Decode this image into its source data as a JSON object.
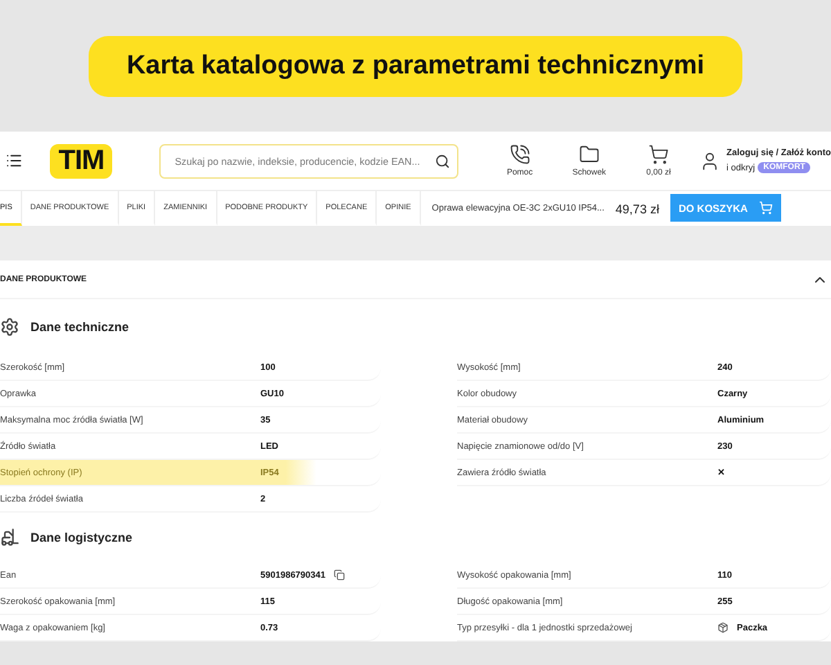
{
  "banner": {
    "title": "Karta katalogowa z parametrami technicznymi"
  },
  "header": {
    "logo": "TIM",
    "search": {
      "placeholder": "Szukaj po nazwie, indeksie, producencie, kodzie EAN..."
    },
    "actions": [
      {
        "kind": "phone",
        "label": "Pomoc"
      },
      {
        "kind": "folder",
        "label": "Schowek"
      },
      {
        "kind": "cart",
        "label": "0,00 zł"
      }
    ],
    "account": {
      "line1": "Zaloguj się / Załóż konto",
      "line2": "i odkryj",
      "badge": "KOMFORT"
    }
  },
  "tabs": [
    {
      "label": "PIS",
      "selected": true
    },
    {
      "label": "DANE PRODUKTOWE",
      "selected": false
    },
    {
      "label": "PLIKI",
      "selected": false
    },
    {
      "label": "ZAMIENNIKI",
      "selected": false
    },
    {
      "label": "PODOBNE PRODUKTY",
      "selected": false
    },
    {
      "label": "POLECANE",
      "selected": false
    },
    {
      "label": "OPINIE",
      "selected": false
    }
  ],
  "product": {
    "name": "Oprawa elewacyjna OE-3C 2xGU10 IP54...",
    "price": "49,73 zł",
    "button": "DO KOSZYKA"
  },
  "panel": {
    "title": "DANE PRODUKTOWE",
    "expanded": true,
    "sections": [
      {
        "kind": "technical",
        "title": "Dane techniczne",
        "left": [
          {
            "label": "Szerokość [mm]",
            "value": "100",
            "highlighted": false,
            "kind": "plain"
          },
          {
            "label": "Oprawka",
            "value": "GU10",
            "highlighted": false,
            "kind": "plain"
          },
          {
            "label": "Maksymalna moc źródła światła [W]",
            "value": "35",
            "highlighted": false,
            "kind": "plain"
          },
          {
            "label": "Źródło światła",
            "value": "LED",
            "highlighted": false,
            "kind": "plain"
          },
          {
            "label": "Stopień ochrony (IP)",
            "value": "IP54",
            "highlighted": true,
            "kind": "plain"
          },
          {
            "label": "Liczba źródeł światła",
            "value": "2",
            "highlighted": false,
            "kind": "plain"
          }
        ],
        "right": [
          {
            "label": "Wysokość [mm]",
            "value": "240",
            "highlighted": false,
            "kind": "plain"
          },
          {
            "label": "Kolor obudowy",
            "value": "Czarny",
            "highlighted": false,
            "kind": "plain"
          },
          {
            "label": "Materiał obudowy",
            "value": "Aluminium",
            "highlighted": false,
            "kind": "plain"
          },
          {
            "label": "Napięcie znamionowe od/do [V]",
            "value": "230",
            "highlighted": false,
            "kind": "plain"
          },
          {
            "label": "Zawiera źródło światła",
            "value": "✕",
            "highlighted": false,
            "kind": "plain"
          }
        ]
      },
      {
        "kind": "logistics",
        "title": "Dane logistyczne",
        "left": [
          {
            "label": "Ean",
            "value": "5901986790341",
            "highlighted": false,
            "kind": "copy"
          },
          {
            "label": "Szerokość opakowania [mm]",
            "value": "115",
            "highlighted": false,
            "kind": "plain"
          },
          {
            "label": "Waga z opakowaniem [kg]",
            "value": "0.73",
            "highlighted": false,
            "kind": "plain"
          }
        ],
        "right": [
          {
            "label": "Wysokość opakowania [mm]",
            "value": "110",
            "highlighted": false,
            "kind": "plain"
          },
          {
            "label": "Długość opakowania [mm]",
            "value": "255",
            "highlighted": false,
            "kind": "plain"
          },
          {
            "label": "Typ przesyłki - dla 1 jednostki sprzedażowej",
            "value": "Paczka",
            "highlighted": false,
            "kind": "package"
          }
        ]
      }
    ]
  }
}
